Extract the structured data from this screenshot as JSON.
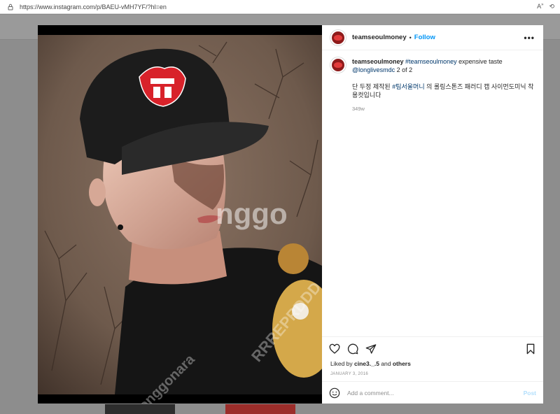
{
  "browser": {
    "url": "https://www.instagram.com/p/BAEU-vMH7YF/?hl=en",
    "icons": [
      "read-aloud-icon",
      "extensions-icon"
    ]
  },
  "post": {
    "username": "teamseoulmoney",
    "follow_label": "Follow",
    "separator": "•",
    "more_label": "•••",
    "caption": {
      "username": "teamseoulmoney",
      "hashtag": "#teamseoulmoney",
      "text": " expensive taste",
      "mention": "@longlivesmdc",
      "suffix": " 2 of 2",
      "korean_prefix": "단 두정 제작된 ",
      "korean_hashtag": "#팀서울머니",
      "korean_rest": " 의 롤링스톤즈 패러디 캡 사이먼도미닉 착용컷입니다",
      "time_ago": "349w"
    },
    "likes": {
      "prefix": "Liked by ",
      "user": "cine3._.5",
      "middle": " and ",
      "others": "others"
    },
    "date": "JANUARY 3, 2016",
    "comment_placeholder": "Add a comment...",
    "post_label": "Post"
  },
  "watermarks": {
    "center": "nggo",
    "right": "RRREPRDDD",
    "bottom": "onggonara"
  },
  "colors": {
    "link_blue": "#0095f6",
    "brand_red": "#e23b3b",
    "post_disabled": "#b2dffc"
  }
}
